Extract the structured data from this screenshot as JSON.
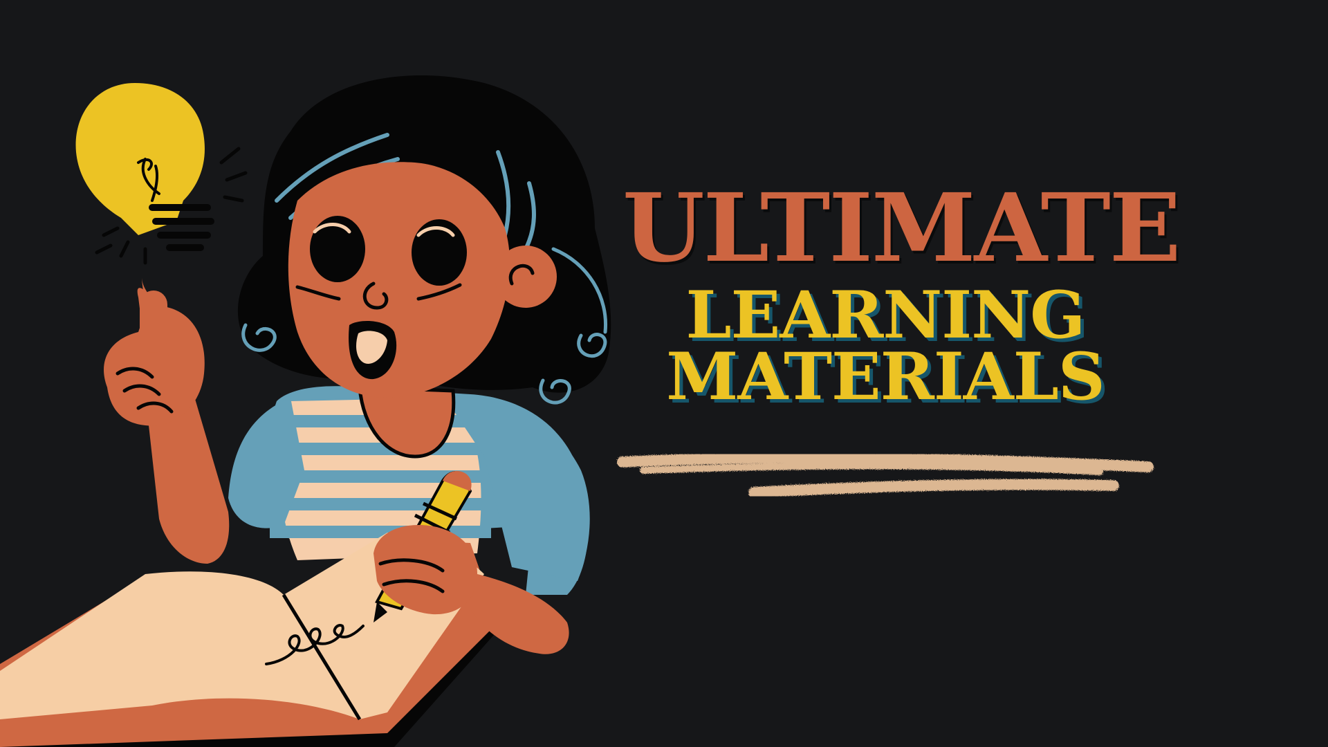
{
  "title": {
    "line1": "ULTIMATE",
    "line2": "LEARNING",
    "line3": "MATERIALS"
  },
  "colors": {
    "background": "#161719",
    "title_primary": "#cd6541",
    "title_secondary": "#ecc324",
    "title_secondary_shadow": "#16566a",
    "chalk_underline": "#f2c9a0",
    "skin": "#cf6843",
    "hair": "#060606",
    "shirt_sleeve": "#65a0b8",
    "shirt_stripe": "#f6ceab",
    "book_page": "#f6cea5",
    "bulb": "#ecc324"
  },
  "illustration": {
    "subject": "girl writing in a book with a pencil, pointing up at a light bulb",
    "icons": [
      "light-bulb-icon",
      "pencil-icon",
      "open-book-icon"
    ]
  }
}
